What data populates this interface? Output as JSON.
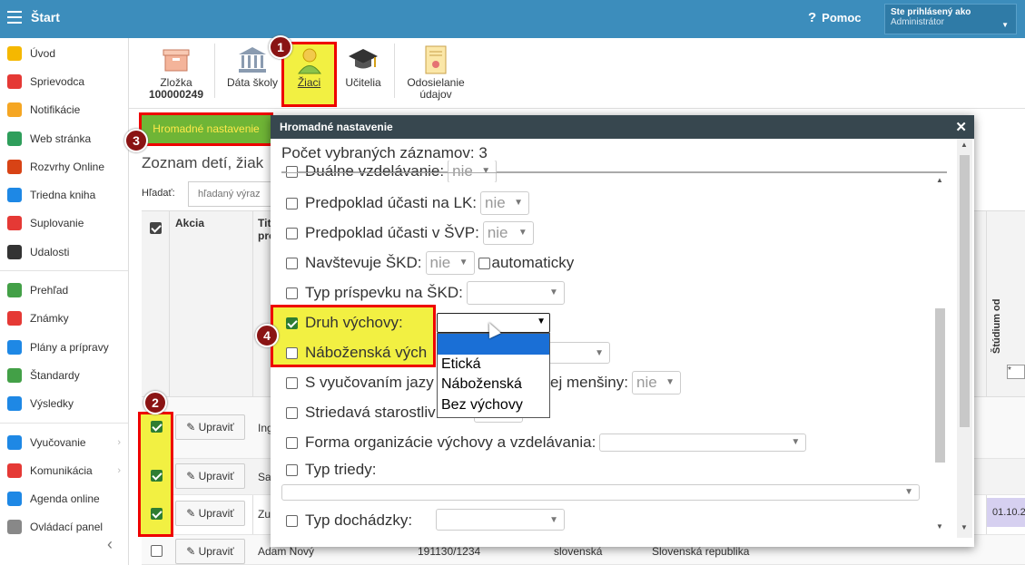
{
  "topbar": {
    "title": "Štart",
    "help": "Pomoc",
    "user_label": "Ste prihlásený ako",
    "user_name": "Administrátor"
  },
  "sidebar": {
    "items": [
      {
        "label": "Úvod",
        "icon": "star-icon",
        "color": "#f5b800"
      },
      {
        "label": "Sprievodca",
        "icon": "wand-icon",
        "color": "#e53935"
      },
      {
        "label": "Notifikácie",
        "icon": "envelope-icon",
        "color": "#f5a623"
      },
      {
        "label": "Web stránka",
        "icon": "home-icon",
        "color": "#2e9e5b"
      },
      {
        "label": "Rozvrhy Online",
        "icon": "calendar-icon",
        "color": "#d84315"
      },
      {
        "label": "Triedna kniha",
        "icon": "book-icon",
        "color": "#1e88e5"
      },
      {
        "label": "Suplovanie",
        "icon": "person-icon",
        "color": "#e53935"
      },
      {
        "label": "Udalosti",
        "icon": "calendar-icon",
        "color": "#333333"
      },
      {
        "label": "Prehľad",
        "icon": "check-circle-icon",
        "color": "#43a047"
      },
      {
        "label": "Známky",
        "icon": "grade-icon",
        "color": "#e53935"
      },
      {
        "label": "Plány a prípravy",
        "icon": "briefcase-icon",
        "color": "#1e88e5"
      },
      {
        "label": "Štandardy",
        "icon": "shield-icon",
        "color": "#43a047"
      },
      {
        "label": "Výsledky",
        "icon": "bar-chart-icon",
        "color": "#1e88e5"
      },
      {
        "label": "Vyučovanie",
        "icon": "book-open-icon",
        "color": "#1e88e5"
      },
      {
        "label": "Komunikácia",
        "icon": "chat-icon",
        "color": "#e53935"
      },
      {
        "label": "Agenda online",
        "icon": "pen-icon",
        "color": "#1e88e5"
      },
      {
        "label": "Ovládací panel",
        "icon": "gear-icon",
        "color": "#888888"
      }
    ]
  },
  "toolbar": {
    "zlozka_label": "Zložka",
    "zlozka_num": "100000249",
    "data_skoly": "Dáta školy",
    "ziaci": "Žiaci",
    "ucitelia": "Učitelia",
    "odosielanie_1": "Odosielanie",
    "odosielanie_2": "údajov"
  },
  "badges": [
    "1",
    "2",
    "3",
    "4"
  ],
  "main": {
    "hromadne_btn": "Hromadné nastavenie",
    "list_title": "Zoznam detí, žiak",
    "search_label": "Hľadať:",
    "search_placeholder": "hľadaný výraz",
    "col_akcia": "Akcia",
    "col_tit_1": "Tit",
    "col_tit_2": "pro",
    "col_studium": "Štúdium od",
    "mini_sel": "*",
    "edit_label": "Upraviť",
    "rows": [
      {
        "name": "Ing",
        "checked": true
      },
      {
        "name": "Sa",
        "checked": true
      },
      {
        "name": "Zu",
        "checked": true
      },
      {
        "name": "Adam Nový",
        "checked": false,
        "rc": "191130/1234",
        "nat": "slovenská",
        "state": "Slovenská republika"
      }
    ],
    "date": "01.10.2"
  },
  "modal": {
    "title": "Hromadné nastavenie",
    "count": "Počet vybraných záznamov: 3",
    "fields": {
      "dualne": "Duálne vzdelávanie:",
      "dualne_val": "nie",
      "lk": "Predpoklad účasti na LK:",
      "lk_val": "nie",
      "svp": "Predpoklad účasti v ŠVP:",
      "svp_val": "nie",
      "skd": "Navštevuje ŠKD:",
      "skd_val": "nie",
      "automaticky": "automaticky",
      "typ_prispevku": "Typ príspevku na ŠKD:",
      "druh": "Druh výchovy:",
      "nabozenska": "Náboženská vých",
      "vyucovanim": "S vyučovaním jazy",
      "mensiny": "ej menšiny:",
      "mensiny_val": "nie",
      "striedava": "Striedavá starostliv",
      "forma": "Forma organizácie výchovy a vzdelávania:",
      "typ_triedy": "Typ triedy:",
      "typ_dochadzky": "Typ dochádzky:"
    },
    "dropdown_options": [
      "",
      "Etická",
      "Náboženská",
      "Bez výchovy"
    ]
  }
}
